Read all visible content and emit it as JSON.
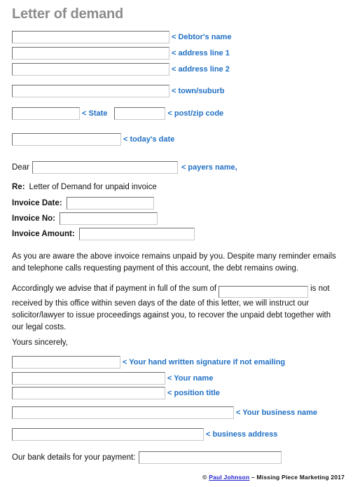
{
  "document": {
    "title": "Letter of demand"
  },
  "colors": {
    "annotation_blue": "#1f6fc4",
    "title_gray": "#8c8c8c",
    "link_blue": "#2222cc",
    "text_black": "#111111"
  },
  "address_block": {
    "fields": [
      {
        "name": "debtor-name",
        "value": "",
        "note": "< Debtor's name"
      },
      {
        "name": "address-line-1",
        "value": "",
        "note": "< address line 1"
      },
      {
        "name": "address-line-2",
        "value": "",
        "note": "< address line 2"
      },
      {
        "name": "town-suburb",
        "value": "",
        "note": "< town/suburb"
      }
    ],
    "state": {
      "value": "",
      "note": "< State"
    },
    "postcode": {
      "value": "",
      "note": "< post/zip code"
    },
    "date": {
      "value": "",
      "note": "< today's date"
    }
  },
  "salutation": {
    "prefix": "Dear",
    "value": "",
    "note": "< payers name,"
  },
  "subject": {
    "prefix": "Re:",
    "text": "Letter of Demand for unpaid invoice"
  },
  "invoice": {
    "date_label": "Invoice Date:",
    "date_value": "",
    "no_label": "Invoice No:",
    "no_value": "",
    "amount_label": "Invoice Amount:",
    "amount_value": ""
  },
  "body": {
    "paragraph_1": "As you are aware the above invoice remains unpaid by you.  Despite many reminder emails and telephone calls requesting payment of this account, the debt remains owing.",
    "paragraph_2_part_1": "Accordingly we advise that if payment in full of the sum of",
    "paragraph_2_amount": "",
    "paragraph_2_part_2": "is not received by this office within seven days of the date of this letter, we will instruct our solicitor/lawyer to issue proceedings against you, to recover the unpaid debt together with our legal costs."
  },
  "closing": {
    "sign_off": "Yours sincerely,",
    "signature": {
      "value": "",
      "note": "< Your hand written signature if not emailing"
    },
    "your_name": {
      "value": "",
      "note": "< Your name"
    },
    "position_title": {
      "value": "",
      "note": "< position title"
    },
    "business_name": {
      "value": "",
      "note": "< Your business name"
    },
    "business_address": {
      "value": "",
      "note": "< business address"
    }
  },
  "bank": {
    "label": "Our bank details for your payment:",
    "value": ""
  },
  "footer": {
    "copyright_symbol": "©",
    "author": "Paul Johnson",
    "rest": "– Missing Piece Marketing 2017"
  }
}
